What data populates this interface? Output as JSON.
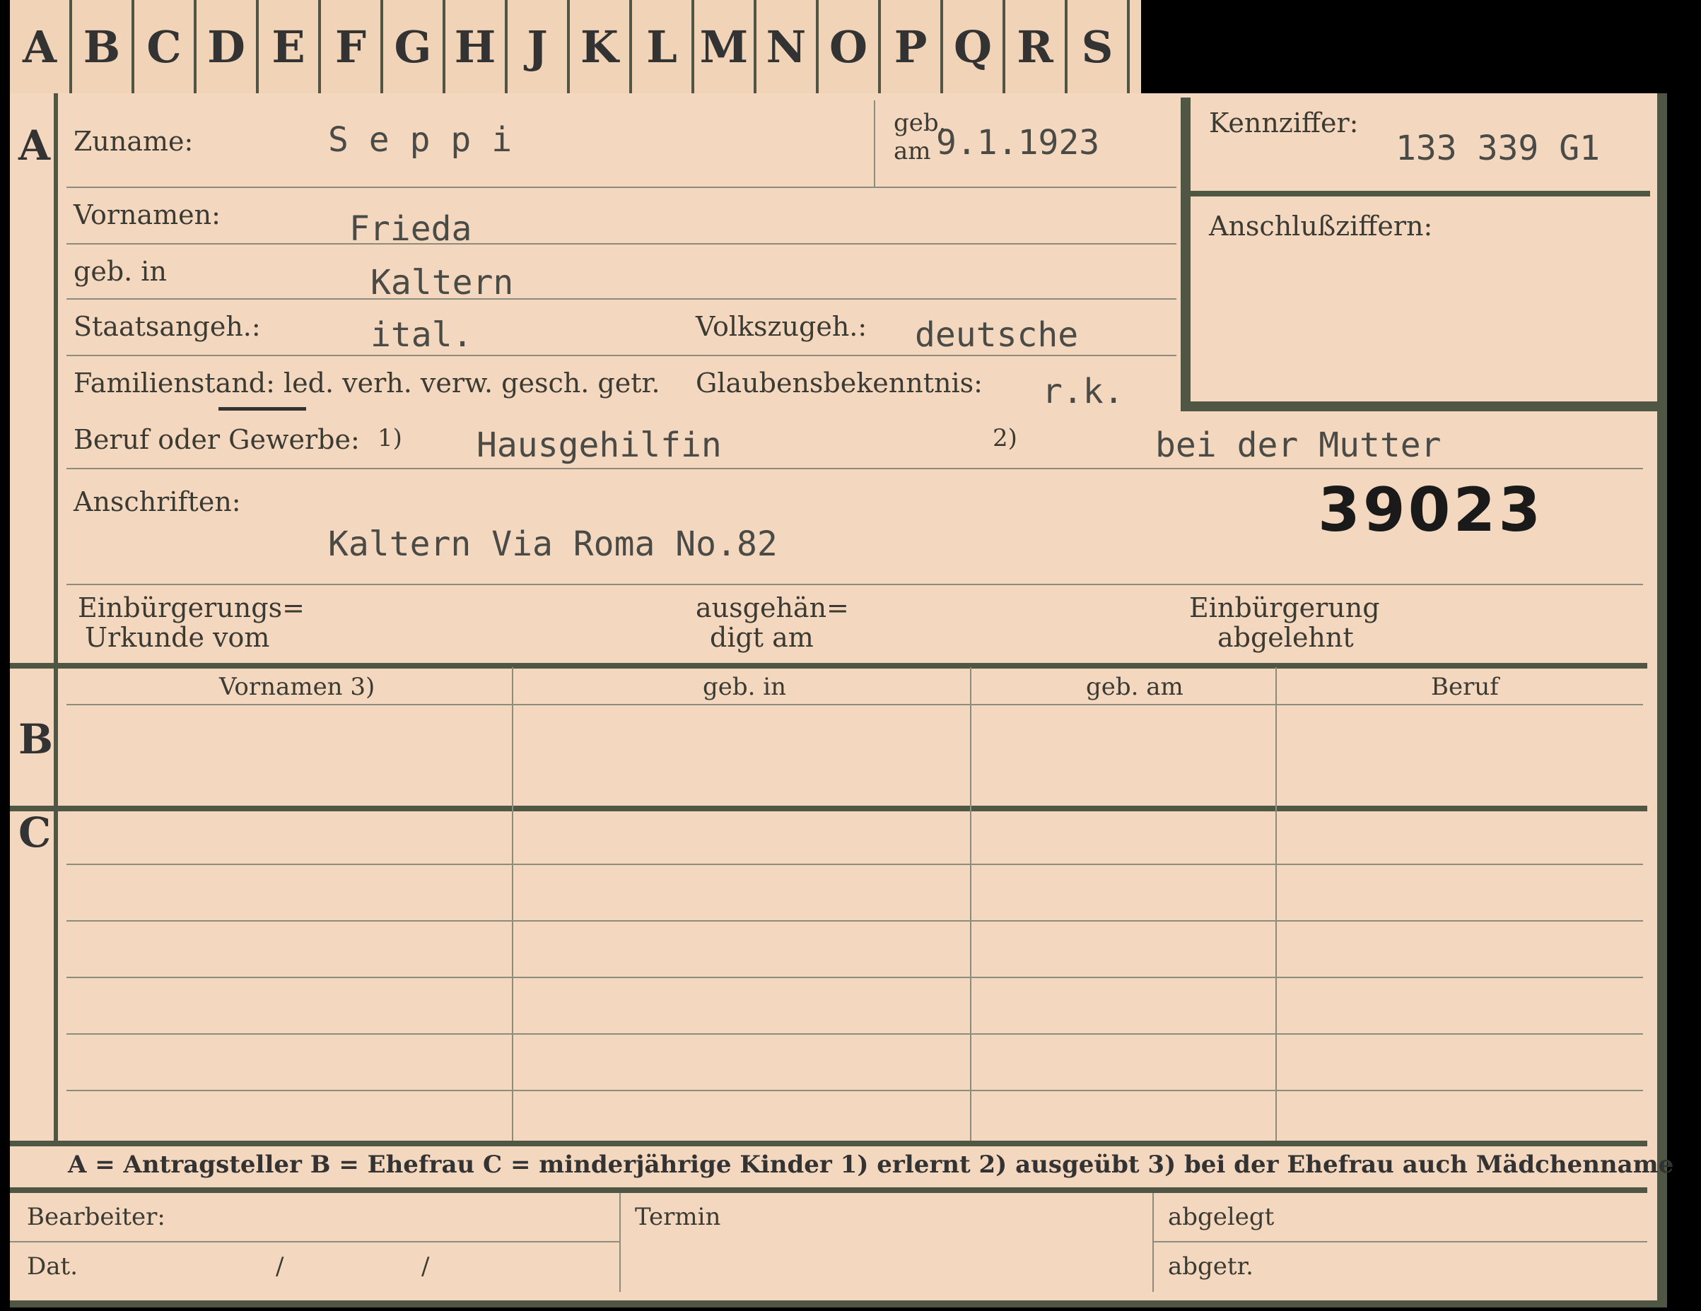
{
  "tabs": [
    "A",
    "B",
    "C",
    "D",
    "E",
    "F",
    "G",
    "H",
    "J",
    "K",
    "L",
    "M",
    "N",
    "O",
    "P",
    "Q",
    "R",
    "S"
  ],
  "sections": {
    "a": "A",
    "b": "B",
    "c": "C"
  },
  "fields": {
    "zuname_label": "Zuname:",
    "zuname": "S e p p i",
    "geb_label_top": "geb.",
    "geb_label_bottom": "am",
    "geb_am": "9.1.1923",
    "kennziffer_label": "Kennziffer:",
    "kennziffer": "133 339  G1",
    "anschluss_label": "Anschlußziffern:",
    "vornamen_label": "Vornamen:",
    "vornamen": "Frieda",
    "gebin_label": "geb. in",
    "gebin": "Kaltern",
    "staat_label": "Staatsangeh.:",
    "staat": "ital.",
    "volk_label": "Volkszugeh.:",
    "volk": "deutsche",
    "familie_label": "Familienstand: led. verh. verw. gesch. getr.",
    "glauben_label": "Glaubensbekenntnis:",
    "glauben": "r.k.",
    "beruf_label": "Beruf oder Gewerbe:",
    "beruf_note1": "1)",
    "beruf1": "Hausgehilfin",
    "beruf_note2": "2)",
    "beruf2": "bei der Mutter",
    "anschriften_label": "Anschriften:",
    "anschrift": "Kaltern Via Roma No.82",
    "stamp_number": "39023",
    "einbuerg_l1": "Einbürgerungs=",
    "einbuerg_l2": "Urkunde vom",
    "ausgeh_l1": "ausgehän=",
    "ausgeh_l2": "digt am",
    "abgelehnt_l1": "Einbürgerung",
    "abgelehnt_l2": "abgelehnt"
  },
  "table": {
    "headers": [
      "Vornamen 3)",
      "geb. in",
      "geb. am",
      "Beruf"
    ]
  },
  "legend": "A = Antragsteller   B = Ehefrau   C = minderjährige Kinder   1) erlernt   2) ausgeübt   3) bei der Ehefrau auch Mädchenname",
  "footer": {
    "bearbeiter": "Bearbeiter:",
    "termin": "Termin",
    "abgelegt": "abgelegt",
    "dat": "Dat.",
    "slash1": "/",
    "slash2": "/",
    "abgetr": "abgetr."
  }
}
